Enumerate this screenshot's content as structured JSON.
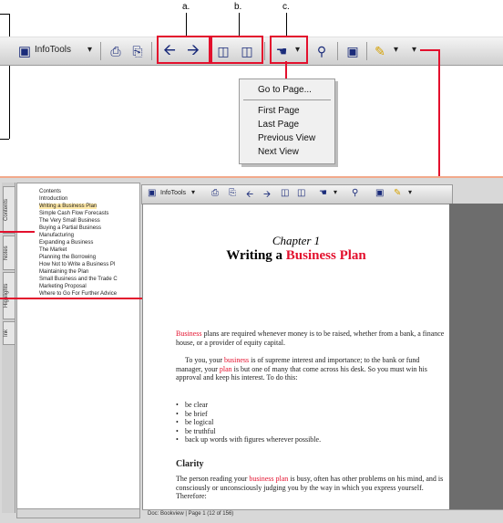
{
  "callout_labels": [
    "a.",
    "b.",
    "c."
  ],
  "toolbar": {
    "infotools_label": "InfoTools",
    "dropdown_arrow": "▾",
    "icons": [
      "document-stack-icon",
      "print-icon",
      "back-arrow-icon",
      "forward-arrow-icon",
      "zoom-box-icon",
      "zoom-box-2-icon",
      "go-to-page-icon",
      "search-icon",
      "bookmark-icon",
      "highlighter-icon"
    ]
  },
  "menu": {
    "items": [
      "Go to Page...",
      "First Page",
      "Last Page",
      "Previous View",
      "Next View"
    ]
  },
  "side_tabs": [
    "Contents",
    "Notes",
    "Highlights",
    "Ink"
  ],
  "toc": {
    "items": [
      "Contents",
      "Introduction",
      "Writing a Business Plan",
      "Simple Cash Flow Forecasts",
      "The Very Small Business",
      "Buying a Partial Business",
      "Manufacturing",
      "Expanding a Business",
      "The Market",
      "Planning the Borrowing",
      "How Not to Write a Business Pl",
      "Maintaining the Plan",
      "Small Business and the Trade C",
      "Marketing Proposal",
      "Where to Go For Further Advice"
    ]
  },
  "page": {
    "chapter_number": "Chapter 1",
    "title_prefix": "Writing a ",
    "title_highlight": "Business Plan",
    "para1_highlight": "Business",
    "para1_rest": " plans are required whenever money is to be raised, whether from a bank, a finance house, or a provider of equity capital.",
    "para2_a": "To you, your ",
    "para2_h1": "business",
    "para2_b": " is of supreme interest and importance; to the bank or fund manager, your ",
    "para2_h2": "plan",
    "para2_c": " is but one of many that come across his desk. So you must win his approval and keep his interest. To do this:",
    "bullets": [
      "be clear",
      "be brief",
      "be logical",
      "be truthful",
      "back up words with figures wherever possible."
    ],
    "section_heading": "Clarity",
    "para3_a": "The person reading your ",
    "para3_h": "business plan",
    "para3_b": " is busy, often has other problems on his mind, and is consciously or unconsciously judging you by the way in which you express yourself. Therefore:"
  },
  "status_bar": {
    "text": "Doc: Bookview | Page 1 (12 of 156)"
  },
  "colors": {
    "accent_red": "#e3102d",
    "icon_blue": "#1a2b7a"
  }
}
